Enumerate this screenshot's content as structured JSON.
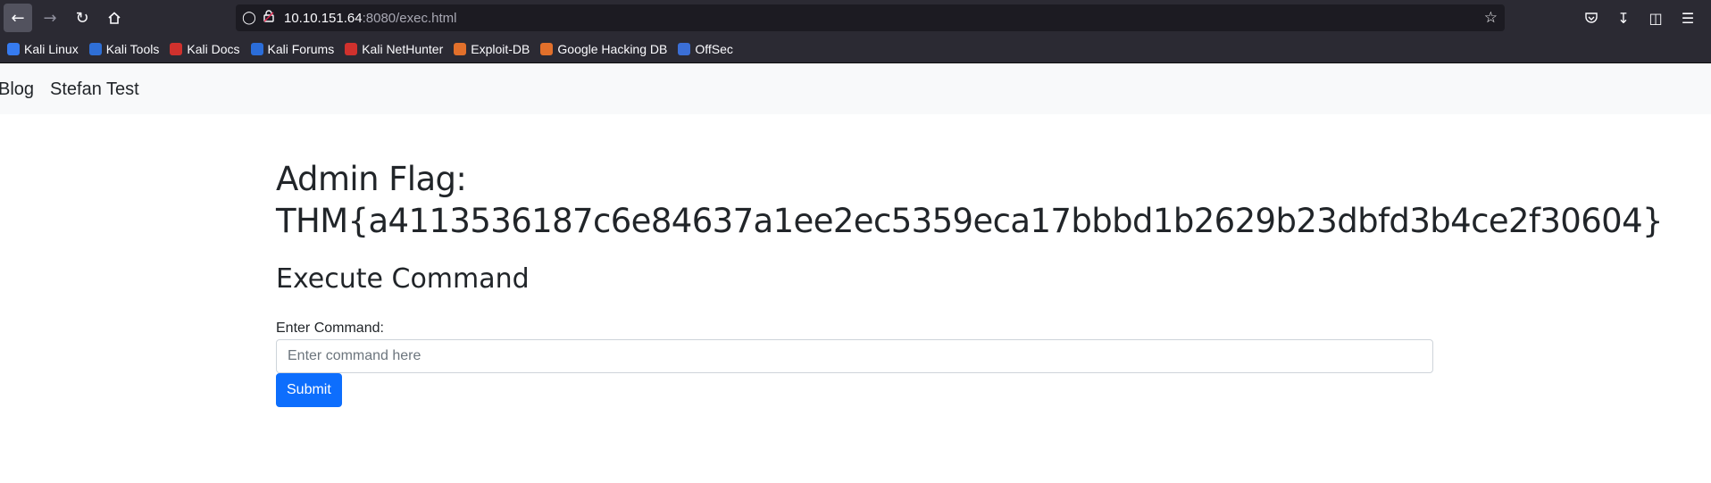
{
  "browser": {
    "url_host": "10.10.151.64",
    "url_rest": ":8080/exec.html",
    "bookmarks": [
      {
        "label": "Kali Linux",
        "color": "#367bf0"
      },
      {
        "label": "Kali Tools",
        "color": "#2f6fd6"
      },
      {
        "label": "Kali Docs",
        "color": "#d0312d"
      },
      {
        "label": "Kali Forums",
        "color": "#2b6dd9"
      },
      {
        "label": "Kali NetHunter",
        "color": "#d0312d"
      },
      {
        "label": "Exploit-DB",
        "color": "#e2702b"
      },
      {
        "label": "Google Hacking DB",
        "color": "#e2702b"
      },
      {
        "label": "OffSec",
        "color": "#3b6fd6"
      }
    ]
  },
  "navbar": {
    "brand": "Blog",
    "link": "Stefan Test"
  },
  "main": {
    "flag_line1": "Admin Flag:",
    "flag_line2": "THM{a4113536187c6e84637a1ee2ec5359eca17bbbd1b2629b23dbfd3b4ce2f30604}",
    "heading": "Execute Command",
    "input_label": "Enter Command:",
    "input_placeholder": "Enter command here",
    "submit_label": "Submit"
  }
}
